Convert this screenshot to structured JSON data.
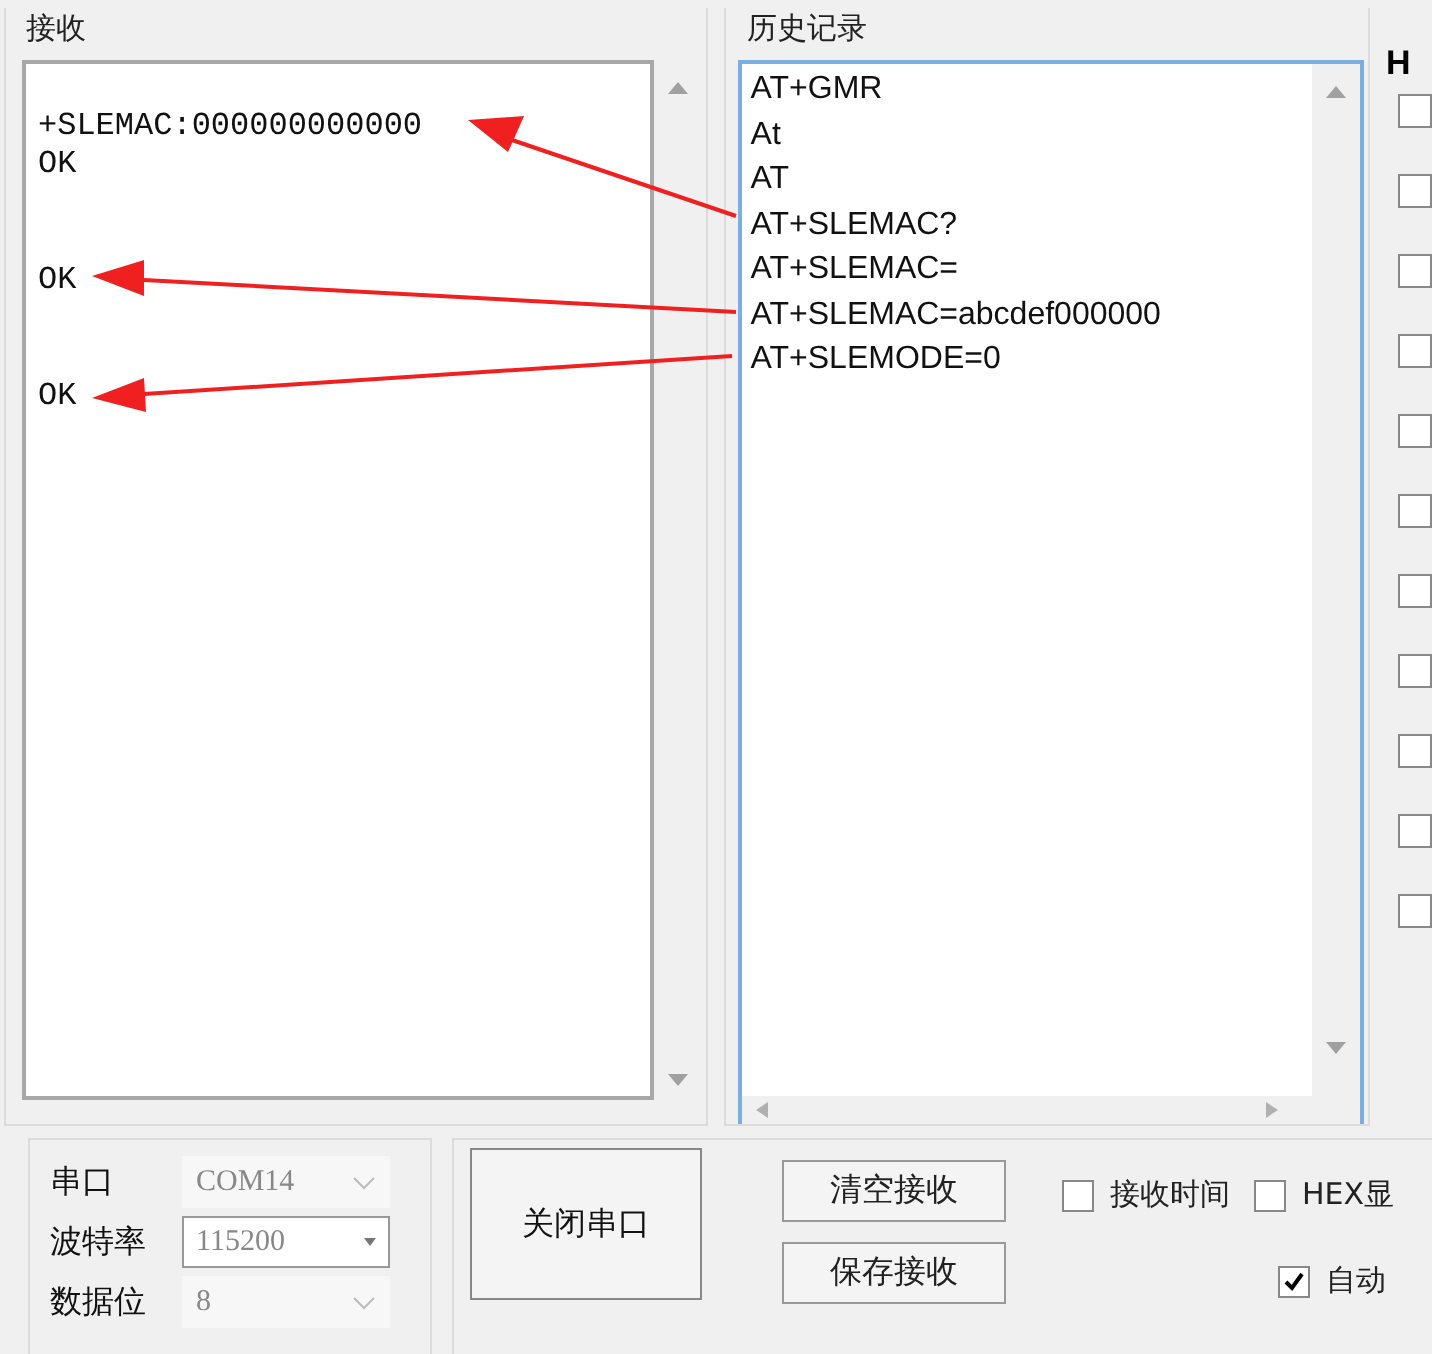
{
  "receive": {
    "title": "接收",
    "text": "+SLEMAC:000000000000\nOK\n\n\nOK\n\n\nOK"
  },
  "history": {
    "title": "历史记录",
    "items": [
      "AT+GMR",
      "At",
      "AT",
      "AT+SLEMAC?",
      "AT+SLEMAC=",
      "AT+SLEMAC=abcdef000000",
      "AT+SLEMODE=0"
    ]
  },
  "side": {
    "heading": "H",
    "checkboxes": [
      {
        "checked": false
      },
      {
        "checked": false
      },
      {
        "checked": false
      },
      {
        "checked": false
      },
      {
        "checked": false
      },
      {
        "checked": false
      },
      {
        "checked": false
      },
      {
        "checked": false
      },
      {
        "checked": false
      },
      {
        "checked": false
      },
      {
        "checked": false
      }
    ]
  },
  "port": {
    "fields": [
      {
        "label": "串口",
        "value": "COM14",
        "disabled": true
      },
      {
        "label": "波特率",
        "value": "115200",
        "disabled": false
      },
      {
        "label": "数据位",
        "value": "8",
        "disabled": true
      }
    ]
  },
  "open_button": "关闭串口",
  "buttons": [
    "清空接收",
    "保存接收"
  ],
  "options": [
    {
      "label": "接收时间",
      "checked": false
    },
    {
      "label": "HEX显",
      "checked": false
    },
    {
      "label": "自动",
      "checked": true
    }
  ]
}
